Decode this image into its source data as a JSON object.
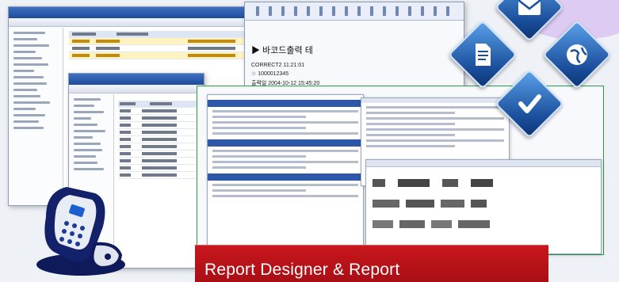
{
  "receipt": {
    "lines": [
      "▶ 바코드출력 테",
      "CORRECT2 11:21:01",
      "☆ 1000012345",
      "출력일 2004-10-12 15:45:20"
    ]
  },
  "caption": {
    "text": "Report Designer & Report"
  },
  "icons": {
    "mail": "mail-icon",
    "document": "document-icon",
    "globe": "globe-icon",
    "check": "check-icon",
    "phone": "mobile-phone-icon"
  },
  "colors": {
    "caption_background": "#b5121b",
    "report_frame_border": "#28a040",
    "accent_blue": "#1d4b98"
  }
}
